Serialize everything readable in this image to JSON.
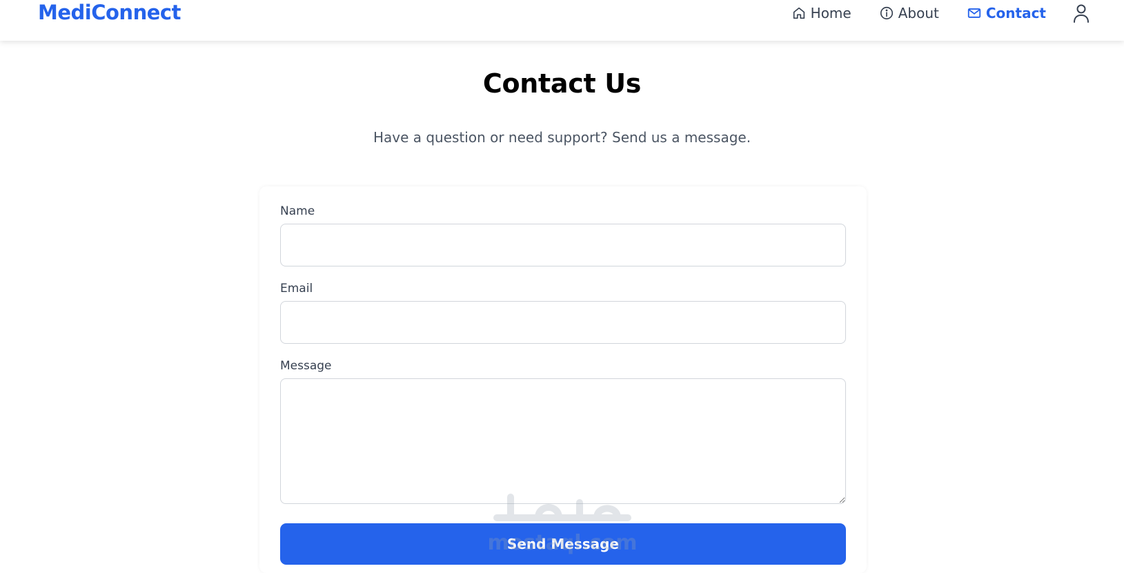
{
  "brand": {
    "name": "MediConnect",
    "color": "#2563eb"
  },
  "nav": {
    "items": [
      {
        "label": "Home",
        "icon": "home-icon",
        "active": false
      },
      {
        "label": "About",
        "icon": "info-icon",
        "active": false
      },
      {
        "label": "Contact",
        "icon": "mail-icon",
        "active": true
      }
    ],
    "user_icon": "user-icon"
  },
  "page": {
    "title": "Contact Us",
    "subtitle": "Have a question or need support? Send us a message."
  },
  "form": {
    "name_label": "Name",
    "name_value": "",
    "email_label": "Email",
    "email_value": "",
    "message_label": "Message",
    "message_value": "",
    "submit_label": "Send Message"
  },
  "watermark": {
    "text": "mostaql.com",
    "arabic": "مستقل"
  },
  "colors": {
    "accent": "#2563eb",
    "text": "#374151",
    "title": "#000000",
    "border": "#d1d5db"
  }
}
